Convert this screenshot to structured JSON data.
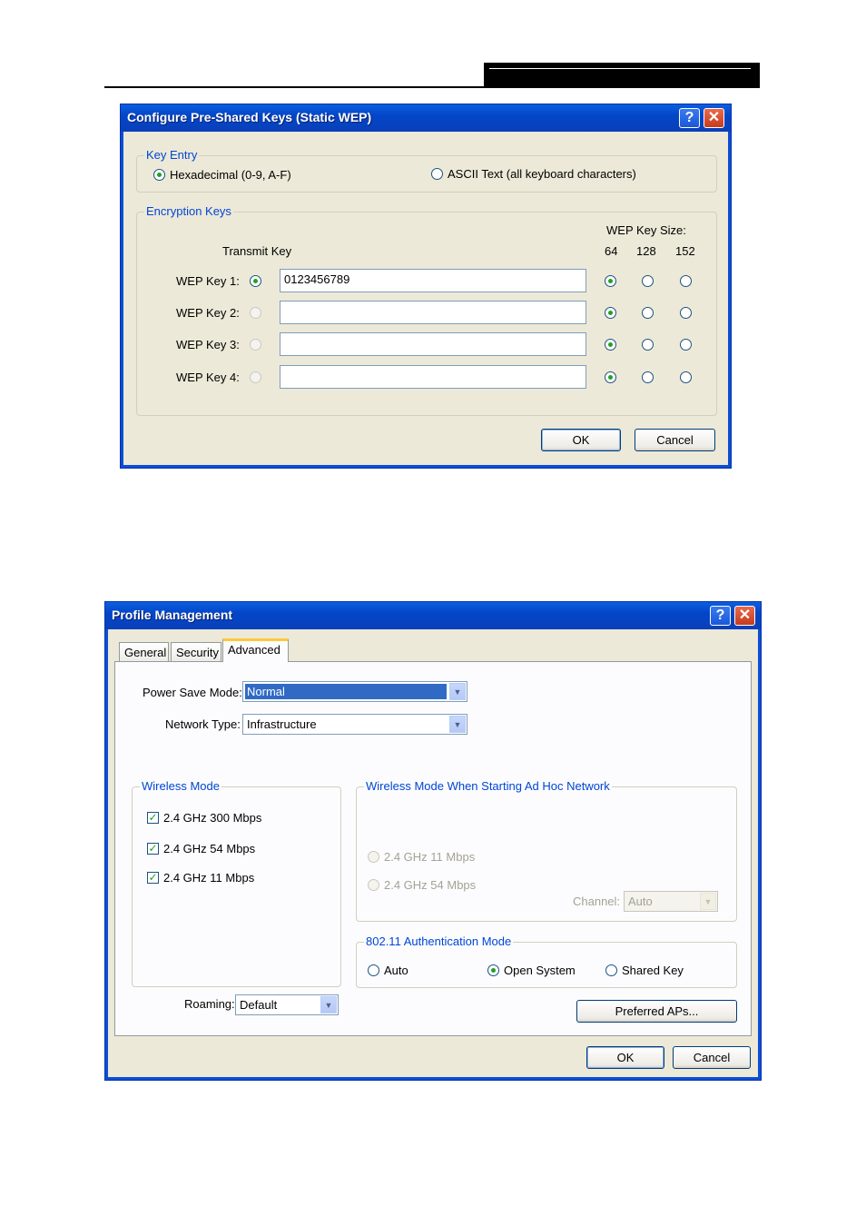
{
  "dialog1": {
    "title": "Configure Pre-Shared Keys (Static WEP)",
    "help_btn": "?",
    "close_btn": "✕",
    "key_entry": {
      "label": "Key Entry",
      "hex_label": "Hexadecimal (0-9, A-F)",
      "ascii_label": "ASCII Text (all keyboard characters)",
      "selected": "hex"
    },
    "encryption_keys": {
      "label": "Encryption Keys",
      "transmit_key_label": "Transmit Key",
      "wep_key_size_label": "WEP Key Size:",
      "size_options": [
        "64",
        "128",
        "152"
      ],
      "keys": [
        {
          "label": "WEP Key 1:",
          "value": "0123456789",
          "transmit": true,
          "size": "64"
        },
        {
          "label": "WEP Key 2:",
          "value": "",
          "transmit": false,
          "size": "64"
        },
        {
          "label": "WEP Key 3:",
          "value": "",
          "transmit": false,
          "size": "64"
        },
        {
          "label": "WEP Key 4:",
          "value": "",
          "transmit": false,
          "size": "64"
        }
      ]
    },
    "ok_label": "OK",
    "cancel_label": "Cancel"
  },
  "dialog2": {
    "title": "Profile Management",
    "help_btn": "?",
    "close_btn": "✕",
    "tabs": [
      "General",
      "Security",
      "Advanced"
    ],
    "active_tab": "Advanced",
    "power_save_mode": {
      "label": "Power Save Mode:",
      "value": "Normal"
    },
    "network_type": {
      "label": "Network Type:",
      "value": "Infrastructure"
    },
    "wireless_mode": {
      "label": "Wireless Mode",
      "options": [
        {
          "label": "2.4 GHz 300 Mbps",
          "checked": true
        },
        {
          "label": "2.4 GHz 54 Mbps",
          "checked": true
        },
        {
          "label": "2.4 GHz 11 Mbps",
          "checked": true
        }
      ]
    },
    "adhoc_mode": {
      "label": "Wireless Mode When Starting Ad Hoc Network",
      "options": [
        "2.4 GHz 11 Mbps",
        "2.4 GHz 54 Mbps"
      ],
      "channel_label": "Channel:",
      "channel_value": "Auto"
    },
    "auth_mode": {
      "label": "802.11 Authentication Mode",
      "options": [
        "Auto",
        "Open System",
        "Shared Key"
      ],
      "selected": "Open System"
    },
    "roaming": {
      "label": "Roaming:",
      "value": "Default"
    },
    "preferred_aps_label": "Preferred APs...",
    "ok_label": "OK",
    "cancel_label": "Cancel"
  },
  "colors": {
    "xp_blue": "#0a4fd6",
    "dialog_bg": "#ece9d8",
    "group_label": "#0046d5",
    "radio_dot": "#21a121"
  }
}
